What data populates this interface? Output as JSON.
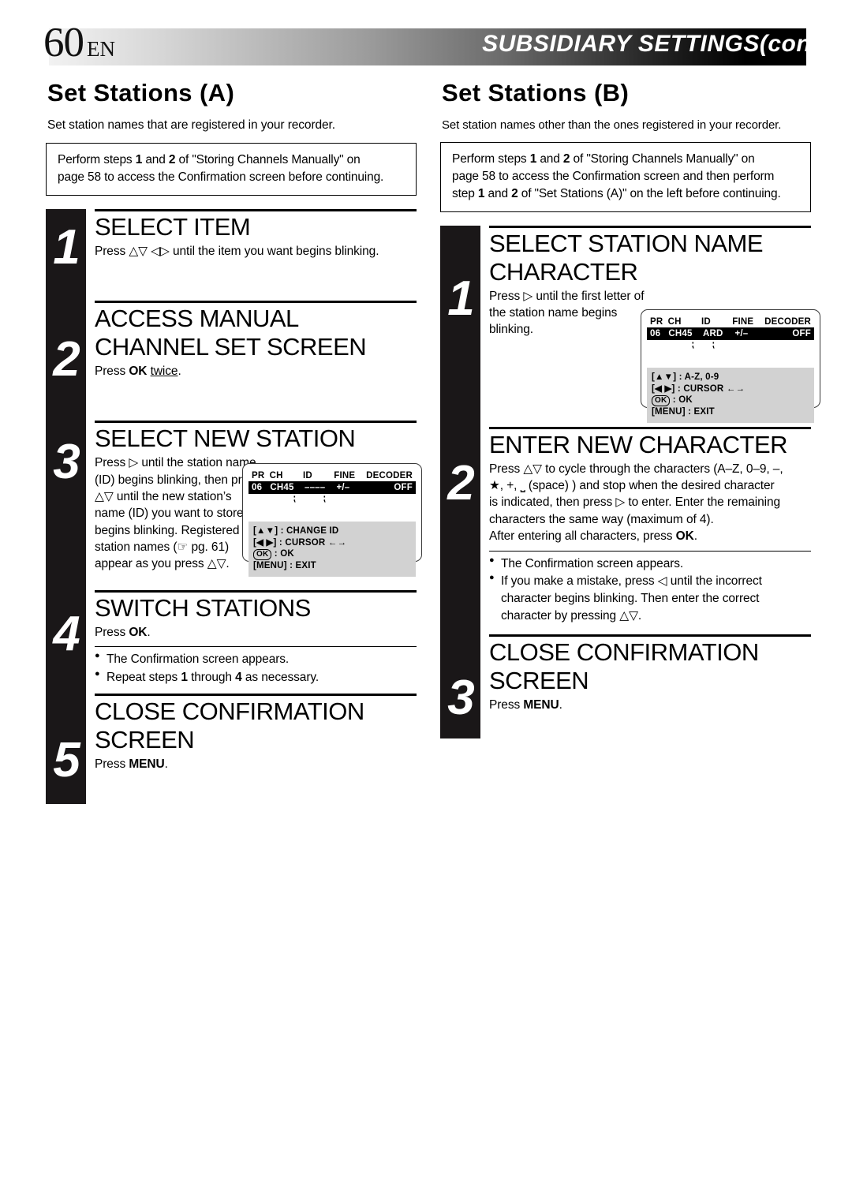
{
  "header": {
    "page_number": "60",
    "language_code": "EN",
    "title": "SUBSIDIARY SETTINGS",
    "title_cont": "(cont.)"
  },
  "left_column": {
    "section_title": "Set Stations (A)",
    "section_subtitle": "Set station names that are registered in your recorder.",
    "note_line1": "Perform steps 1 and 2 of \"Storing Channels Manually\" on",
    "note_line2": "page 58 to access the Confirmation screen before continuing.",
    "steps": [
      {
        "number": "1",
        "heading": "SELECT ITEM",
        "text": "Press △▽ ◁▷ until the item you want begins blinking."
      },
      {
        "number": "2",
        "heading_line1": "ACCESS MANUAL",
        "heading_line2": "CHANNEL SET SCREEN",
        "text_pre": "Press ",
        "text_bold": "OK",
        "text_underline": "twice",
        "text_post": "."
      },
      {
        "number": "3",
        "heading": "SELECT NEW STATION",
        "text": "Press ▷ until the station name (ID) begins blinking, then press △▽ until the new station’s name (ID) you want to store begins blinking. Registered station names (☞ pg. 61) appear as you press △▽."
      },
      {
        "number": "4",
        "heading": "SWITCH STATIONS",
        "text_pre": "Press ",
        "text_bold": "OK",
        "text_post": ".",
        "bullet1": "The Confirmation screen appears.",
        "bullet2_pre": "Repeat steps ",
        "bullet2_b1": "1",
        "bullet2_mid": " through ",
        "bullet2_b2": "4",
        "bullet2_post": " as necessary."
      },
      {
        "number": "5",
        "heading_line1": "CLOSE CONFIRMATION",
        "heading_line2": "SCREEN",
        "text_pre": "Press ",
        "text_bold": "MENU",
        "text_post": "."
      }
    ],
    "tv_screen": {
      "headers": [
        "PR",
        "CH",
        "ID",
        "FINE",
        "DECODER"
      ],
      "values": [
        "06",
        "CH45",
        "––––",
        "+/–",
        "OFF"
      ],
      "legend": [
        "[▲▼] : CHANGE ID",
        "[◀ ▶] : CURSOR ←→",
        "OK : OK",
        "[MENU] : EXIT"
      ]
    }
  },
  "right_column": {
    "section_title": "Set Stations (B)",
    "section_subtitle": "Set station names other than the ones registered in your recorder.",
    "note_line1": "Perform steps 1 and 2 of \"Storing Channels Manually\" on",
    "note_line2": "page 58 to access the Confirmation screen and then perform",
    "note_line3": "step 1 and 2 of \"Set Stations (A)\" on the left before continuing.",
    "steps": [
      {
        "number": "1",
        "heading_line1": "SELECT STATION NAME",
        "heading_line2": "CHARACTER",
        "text": "Press ▷ until the first letter of the station name begins blinking."
      },
      {
        "number": "2",
        "heading": "ENTER NEW CHARACTER",
        "text_line1": "Press △▽ to cycle through the characters (A–Z, 0–9, –,",
        "text_line2": "★, +, ⎵ (space) ) and stop when the desired character",
        "text_line3": "is indicated, then press ▷ to enter. Enter the remaining",
        "text_line4": "characters the same way (maximum of 4).",
        "text_line5_pre": "After entering all characters, press ",
        "text_line5_bold": "OK",
        "text_line5_post": ".",
        "bullet1": "The Confirmation screen appears.",
        "bullet2_line1": "If you make a mistake, press ◁ until the incorrect",
        "bullet2_line2": "character begins blinking. Then enter the correct",
        "bullet2_line3": "character by pressing △▽."
      },
      {
        "number": "3",
        "heading_line1": "CLOSE CONFIRMATION",
        "heading_line2": "SCREEN",
        "text_pre": "Press ",
        "text_bold": "MENU",
        "text_post": "."
      }
    ],
    "tv_screen": {
      "headers": [
        "PR",
        "CH",
        "ID",
        "FINE",
        "DECODER"
      ],
      "values": [
        "06",
        "CH45",
        "ARD",
        "+/–",
        "OFF"
      ],
      "legend": [
        "[▲▼] : A-Z, 0-9",
        "[◀ ▶] : CURSOR ←→",
        "OK : OK",
        "[MENU] : EXIT"
      ]
    }
  },
  "colors": {
    "ink": "#000000",
    "numbar": "#1a1718",
    "legend_bg": "#d2d2d2"
  }
}
